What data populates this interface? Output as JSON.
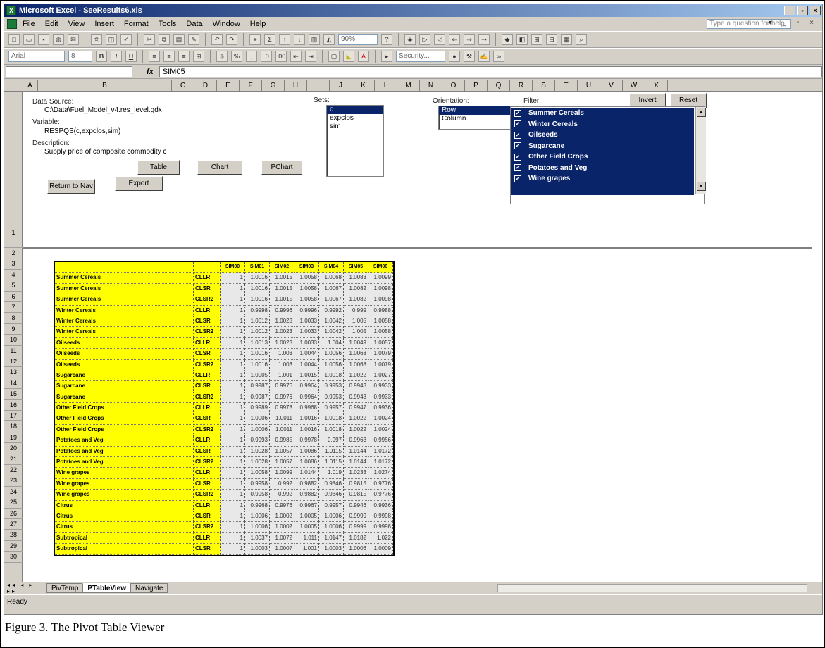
{
  "window": {
    "title": "Microsoft Excel - SeeResults6.xls",
    "controls": [
      "_",
      "▫",
      "×"
    ]
  },
  "menu": {
    "items": [
      "File",
      "Edit",
      "View",
      "Insert",
      "Format",
      "Tools",
      "Data",
      "Window",
      "Help"
    ],
    "help_placeholder": "Type a question for help",
    "mdi_controls": "▾ _ ▫ ×"
  },
  "toolbar": {
    "zoom": "90%",
    "font_name": "Arial",
    "font_size": "8",
    "security_label": "Security..."
  },
  "formula_bar": {
    "name_box": "",
    "fx": "fx",
    "formula": "SIM05"
  },
  "columns": [
    "A",
    "B",
    "C",
    "D",
    "E",
    "F",
    "G",
    "H",
    "I",
    "J",
    "K",
    "L",
    "M",
    "N",
    "O",
    "P",
    "Q",
    "R",
    "S",
    "T",
    "U",
    "V",
    "W",
    "X"
  ],
  "rows": [
    "1",
    "2",
    "3",
    "4",
    "5",
    "6",
    "7",
    "8",
    "9",
    "10",
    "11",
    "12",
    "13",
    "14",
    "15",
    "16",
    "17",
    "18",
    "19",
    "20",
    "21",
    "22",
    "23",
    "24",
    "25",
    "26",
    "27",
    "28",
    "29",
    "30"
  ],
  "panel": {
    "data_source_label": "Data Source:",
    "data_source_value": "C:\\Data\\Fuel_Model_v4.res_level.gdx",
    "variable_label": "Variable:",
    "variable_value": "RESPQS(c,expclos,sim)",
    "description_label": "Description:",
    "description_value": "Supply price of composite commodity c",
    "sets_label": "Sets:",
    "sets": [
      "c",
      "expclos",
      "sim"
    ],
    "orientation_label": "Orientation:",
    "orientation": [
      "Row",
      "Column"
    ],
    "filter_label": "Filter:",
    "filter_items": [
      "Summer Cereals",
      "Winter Cereals",
      "Oilseeds",
      "Sugarcane",
      "Other Field Crops",
      "Potatoes and Veg",
      "Wine grapes"
    ],
    "buttons": {
      "table": "Table",
      "chart": "Chart",
      "pchart": "PChart",
      "return_to_nav": "Return to Nav",
      "export": "Export",
      "invert": "Invert",
      "reset": "Reset"
    }
  },
  "pivot": {
    "headers": [
      "SIM00",
      "SIM01",
      "SIM02",
      "SIM03",
      "SIM04",
      "SIM05",
      "SIM06"
    ],
    "rows": [
      {
        "label": "Summer Cereals",
        "code": "CLLR",
        "values": [
          "1",
          "1.0016",
          "1.0015",
          "1.0058",
          "1.0068",
          "1.0083",
          "1.0099"
        ]
      },
      {
        "label": "Summer Cereals",
        "code": "CLSR",
        "values": [
          "1",
          "1.0016",
          "1.0015",
          "1.0058",
          "1.0067",
          "1.0082",
          "1.0098"
        ]
      },
      {
        "label": "Summer Cereals",
        "code": "CLSR2",
        "values": [
          "1",
          "1.0016",
          "1.0015",
          "1.0058",
          "1.0067",
          "1.0082",
          "1.0098"
        ]
      },
      {
        "label": "Winter Cereals",
        "code": "CLLR",
        "values": [
          "1",
          "0.9998",
          "0.9996",
          "0.9996",
          "0.9992",
          "0.999",
          "0.9988"
        ]
      },
      {
        "label": "Winter Cereals",
        "code": "CLSR",
        "values": [
          "1",
          "1.0012",
          "1.0023",
          "1.0033",
          "1.0042",
          "1.005",
          "1.0058"
        ]
      },
      {
        "label": "Winter Cereals",
        "code": "CLSR2",
        "values": [
          "1",
          "1.0012",
          "1.0023",
          "1.0033",
          "1.0042",
          "1.005",
          "1.0058"
        ]
      },
      {
        "label": "Oilseeds",
        "code": "CLLR",
        "values": [
          "1",
          "1.0013",
          "1.0023",
          "1.0033",
          "1.004",
          "1.0049",
          "1.0057"
        ]
      },
      {
        "label": "Oilseeds",
        "code": "CLSR",
        "values": [
          "1",
          "1.0016",
          "1.003",
          "1.0044",
          "1.0056",
          "1.0068",
          "1.0079"
        ]
      },
      {
        "label": "Oilseeds",
        "code": "CLSR2",
        "values": [
          "1",
          "1.0016",
          "1.003",
          "1.0044",
          "1.0056",
          "1.0068",
          "1.0079"
        ]
      },
      {
        "label": "Sugarcane",
        "code": "CLLR",
        "values": [
          "1",
          "1.0005",
          "1.001",
          "1.0015",
          "1.0018",
          "1.0022",
          "1.0027"
        ]
      },
      {
        "label": "Sugarcane",
        "code": "CLSR",
        "values": [
          "1",
          "0.9987",
          "0.9976",
          "0.9964",
          "0.9953",
          "0.9943",
          "0.9933"
        ]
      },
      {
        "label": "Sugarcane",
        "code": "CLSR2",
        "values": [
          "1",
          "0.9987",
          "0.9976",
          "0.9964",
          "0.9953",
          "0.9943",
          "0.9933"
        ]
      },
      {
        "label": "Other Field Crops",
        "code": "CLLR",
        "values": [
          "1",
          "0.9989",
          "0.9978",
          "0.9968",
          "0.9957",
          "0.9947",
          "0.9936"
        ]
      },
      {
        "label": "Other Field Crops",
        "code": "CLSR",
        "values": [
          "1",
          "1.0006",
          "1.0011",
          "1.0016",
          "1.0018",
          "1.0022",
          "1.0024"
        ]
      },
      {
        "label": "Other Field Crops",
        "code": "CLSR2",
        "values": [
          "1",
          "1.0006",
          "1.0011",
          "1.0016",
          "1.0018",
          "1.0022",
          "1.0024"
        ]
      },
      {
        "label": "Potatoes and Veg",
        "code": "CLLR",
        "values": [
          "1",
          "0.9993",
          "0.9985",
          "0.9978",
          "0.997",
          "0.9963",
          "0.9956"
        ]
      },
      {
        "label": "Potatoes and Veg",
        "code": "CLSR",
        "values": [
          "1",
          "1.0028",
          "1.0057",
          "1.0086",
          "1.0115",
          "1.0144",
          "1.0172"
        ]
      },
      {
        "label": "Potatoes and Veg",
        "code": "CLSR2",
        "values": [
          "1",
          "1.0028",
          "1.0057",
          "1.0086",
          "1.0115",
          "1.0144",
          "1.0172"
        ]
      },
      {
        "label": "Wine grapes",
        "code": "CLLR",
        "values": [
          "1",
          "1.0058",
          "1.0099",
          "1.0144",
          "1.019",
          "1.0233",
          "1.0274"
        ]
      },
      {
        "label": "Wine grapes",
        "code": "CLSR",
        "values": [
          "1",
          "0.9958",
          "0.992",
          "0.9882",
          "0.9846",
          "0.9815",
          "0.9776"
        ]
      },
      {
        "label": "Wine grapes",
        "code": "CLSR2",
        "values": [
          "1",
          "0.9958",
          "0.992",
          "0.9882",
          "0.9846",
          "0.9815",
          "0.9776"
        ]
      },
      {
        "label": "Citrus",
        "code": "CLLR",
        "values": [
          "1",
          "0.9968",
          "0.9976",
          "0.9967",
          "0.9957",
          "0.9946",
          "0.9936"
        ]
      },
      {
        "label": "Citrus",
        "code": "CLSR",
        "values": [
          "1",
          "1.0006",
          "1.0002",
          "1.0005",
          "1.0006",
          "0.9999",
          "0.9998"
        ]
      },
      {
        "label": "Citrus",
        "code": "CLSR2",
        "values": [
          "1",
          "1.0006",
          "1.0002",
          "1.0005",
          "1.0006",
          "0.9999",
          "0.9998"
        ]
      },
      {
        "label": "Subtropical",
        "code": "CLLR",
        "values": [
          "1",
          "1.0037",
          "1.0072",
          "1.011",
          "1.0147",
          "1.0182",
          "1.022"
        ]
      },
      {
        "label": "Subtropical",
        "code": "CLSR",
        "values": [
          "1",
          "1.0003",
          "1.0007",
          "1.001",
          "1.0003",
          "1.0006",
          "1.0009"
        ]
      }
    ]
  },
  "sheet_tabs": [
    "PivTemp",
    "PTableView",
    "Navigate"
  ],
  "tab_nav": "◂◂ ◂ ▸ ▸▸",
  "status": "Ready",
  "caption": "Figure 3. The Pivot Table Viewer"
}
